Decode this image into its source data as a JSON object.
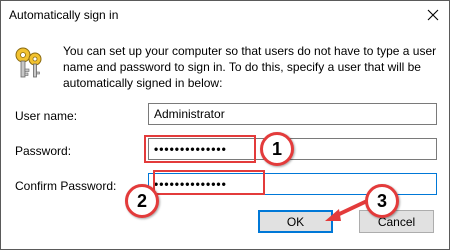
{
  "dialog": {
    "title": "Automatically sign in",
    "description": "You can set up your computer so that users do not have to type a user name and password to sign in. To do this, specify a user that will be automatically signed in below:",
    "icon": "keys-icon"
  },
  "form": {
    "user_name_label": "User name:",
    "user_name_value": "Administrator",
    "password_label": "Password:",
    "password_value": "••••••••••••••",
    "confirm_password_label": "Confirm Password:",
    "confirm_password_value": "••••••••••••••"
  },
  "buttons": {
    "ok_label": "OK",
    "cancel_label": "Cancel"
  },
  "annotations": {
    "step1": "1",
    "step2": "2",
    "step3": "3",
    "color": "#e33b3b"
  },
  "colors": {
    "focus_border": "#0078d7",
    "button_bg": "#e1e1e1"
  }
}
